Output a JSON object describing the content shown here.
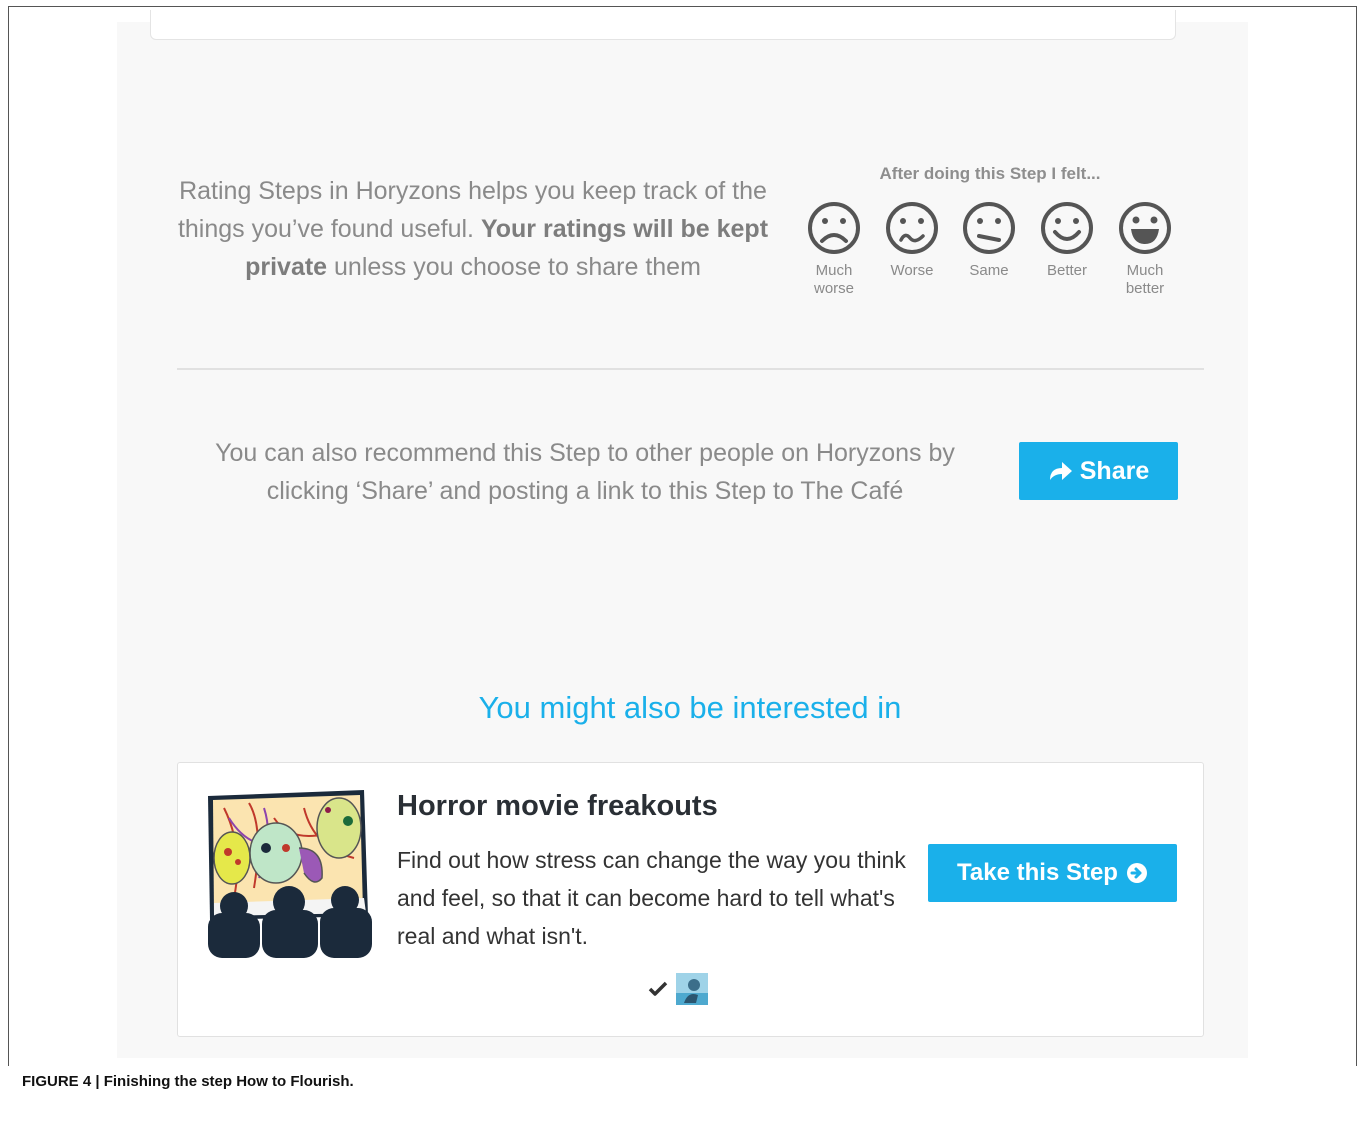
{
  "rating": {
    "text_part1": "Rating Steps in Horyzons helps you keep track of the things you’ve found useful. ",
    "text_bold": "Your ratings will be kept private",
    "text_part2": " unless you choose to share them",
    "felt_title": "After doing this Step I felt...",
    "options": [
      {
        "label": "Much worse",
        "icon": "much-worse-face-icon"
      },
      {
        "label": "Worse",
        "icon": "worse-face-icon"
      },
      {
        "label": "Same",
        "icon": "same-face-icon"
      },
      {
        "label": "Better",
        "icon": "better-face-icon"
      },
      {
        "label": "Much better",
        "icon": "much-better-face-icon"
      }
    ]
  },
  "share": {
    "text": "You can also recommend this Step to other people on Horyzons by clicking ‘Share’ and posting a link to this Step to The Café",
    "button_label": "Share",
    "button_icon": "share-arrow-icon"
  },
  "recommendations": {
    "heading": "You might also be interested in",
    "items": [
      {
        "title": "Horror movie freakouts",
        "description": "Find out how stress can change the way you think and feel, so that it can become hard to tell what's real and what isn't.",
        "button_label": "Take this Step",
        "button_icon": "circle-arrow-right-icon",
        "meta_icons": [
          "checkmark-icon",
          "avatar-icon"
        ]
      }
    ]
  },
  "caption": "FIGURE 4 | Finishing the step How to Flourish.",
  "colors": {
    "accent": "#1ab0ea",
    "background": "#f8f8f8",
    "muted_text": "#8a8a8a"
  }
}
